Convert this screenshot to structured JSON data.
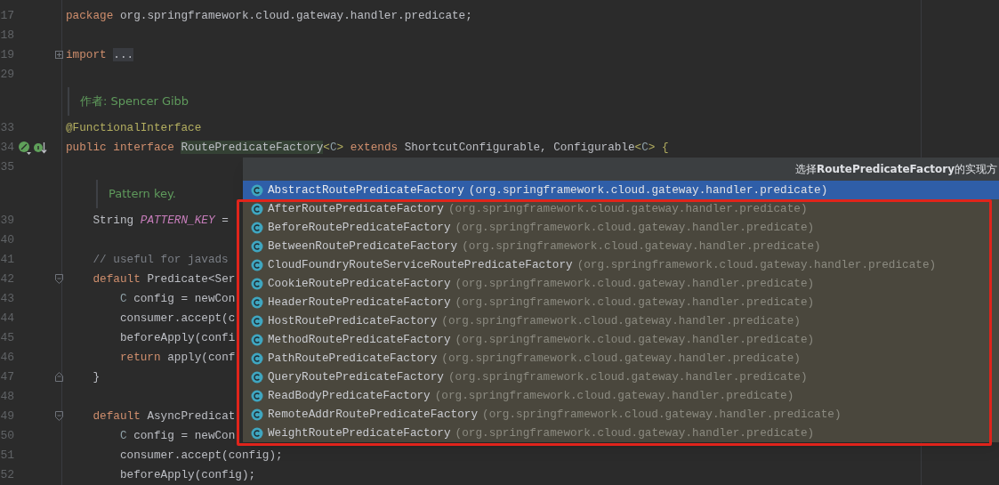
{
  "editor": {
    "lines": [
      {
        "kind": "code",
        "num": "17",
        "tokens": [
          {
            "t": "package ",
            "kind": "kw"
          },
          {
            "t": "org.springframework.cloud.gateway.handler.predicate;",
            "kind": "plain"
          }
        ]
      },
      {
        "kind": "code",
        "num": "18"
      },
      {
        "kind": "code",
        "num": "19",
        "fold": {
          "kind": "collapsed"
        },
        "tokens": [
          {
            "t": "import ",
            "kind": "kw"
          },
          {
            "t": "...",
            "kind": "folded"
          }
        ]
      },
      {
        "kind": "code",
        "num": "29"
      },
      {
        "kind": "doc",
        "text": "作者: Spencer Gibb"
      },
      {
        "kind": "code",
        "num": "33",
        "tokens": [
          {
            "t": "@FunctionalInterface",
            "kind": "annotation"
          }
        ]
      },
      {
        "kind": "code",
        "num": "34",
        "gutter_icons": true,
        "tokens": [
          {
            "t": "public interface ",
            "kind": "kw"
          },
          {
            "t": "RoutePredicateFactory",
            "kind": "highlight"
          },
          {
            "t": "<",
            "kind": "annotation"
          },
          {
            "t": "C",
            "kind": "tparam"
          },
          {
            "t": "> ",
            "kind": "annotation"
          },
          {
            "t": "extends ",
            "kind": "kw"
          },
          {
            "t": "ShortcutConfigurable, Configurable",
            "kind": "plain"
          },
          {
            "t": "<",
            "kind": "annotation"
          },
          {
            "t": "C",
            "kind": "tparam"
          },
          {
            "t": "> {",
            "kind": "annotation"
          }
        ]
      },
      {
        "kind": "code",
        "num": "35"
      },
      {
        "kind": "member_doc",
        "text": "Pattern key."
      },
      {
        "kind": "code",
        "num": "39",
        "tokens": [
          {
            "t": "    String ",
            "kind": "plain"
          },
          {
            "t": "PATTERN_KEY",
            "kind": "static"
          },
          {
            "t": " =",
            "kind": "plain"
          }
        ]
      },
      {
        "kind": "code",
        "num": "40"
      },
      {
        "kind": "code",
        "num": "41",
        "tokens": [
          {
            "t": "    // useful for javads",
            "kind": "comment"
          }
        ]
      },
      {
        "kind": "code",
        "num": "42",
        "fold": {
          "kind": "start"
        },
        "tokens": [
          {
            "t": "    default ",
            "kind": "kw"
          },
          {
            "t": "Predicate<Ser",
            "kind": "plain"
          }
        ]
      },
      {
        "kind": "code",
        "num": "43",
        "tokens": [
          {
            "t": "        C",
            "kind": "tparam"
          },
          {
            "t": " config = newCon",
            "kind": "plain"
          }
        ]
      },
      {
        "kind": "code",
        "num": "44",
        "tokens": [
          {
            "t": "        consumer.accept(c",
            "kind": "plain"
          }
        ]
      },
      {
        "kind": "code",
        "num": "45",
        "tokens": [
          {
            "t": "        beforeApply(confi",
            "kind": "plain"
          }
        ]
      },
      {
        "kind": "code",
        "num": "46",
        "tokens": [
          {
            "t": "        return ",
            "kind": "kw"
          },
          {
            "t": "apply(conf",
            "kind": "plain"
          }
        ]
      },
      {
        "kind": "code",
        "num": "47",
        "fold": {
          "kind": "end"
        },
        "tokens": [
          {
            "t": "    }",
            "kind": "plain"
          }
        ]
      },
      {
        "kind": "code",
        "num": "48"
      },
      {
        "kind": "code",
        "num": "49",
        "fold": {
          "kind": "start"
        },
        "tokens": [
          {
            "t": "    default ",
            "kind": "kw"
          },
          {
            "t": "AsyncPredicat",
            "kind": "plain"
          }
        ]
      },
      {
        "kind": "code",
        "num": "50",
        "tokens": [
          {
            "t": "        C",
            "kind": "tparam"
          },
          {
            "t": " config = newCon",
            "kind": "plain"
          }
        ]
      },
      {
        "kind": "code",
        "num": "51",
        "tokens": [
          {
            "t": "        consumer.accept(config);",
            "kind": "plain"
          }
        ]
      },
      {
        "kind": "code",
        "num": "52",
        "tokens": [
          {
            "t": "        beforeApply(config);",
            "kind": "plain"
          }
        ]
      }
    ]
  },
  "popup": {
    "title": "选择**RoutePredicateFactory**的实现方",
    "items": [
      {
        "name": "AbstractRoutePredicateFactory",
        "package": "(org.springframework.cloud.gateway.handler.predicate)",
        "selected": true
      },
      {
        "name": "AfterRoutePredicateFactory",
        "package": "(org.springframework.cloud.gateway.handler.predicate)",
        "selected": false
      },
      {
        "name": "BeforeRoutePredicateFactory",
        "package": "(org.springframework.cloud.gateway.handler.predicate)",
        "selected": false
      },
      {
        "name": "BetweenRoutePredicateFactory",
        "package": "(org.springframework.cloud.gateway.handler.predicate)",
        "selected": false
      },
      {
        "name": "CloudFoundryRouteServiceRoutePredicateFactory",
        "package": "(org.springframework.cloud.gateway.handler.predicate)",
        "selected": false
      },
      {
        "name": "CookieRoutePredicateFactory",
        "package": "(org.springframework.cloud.gateway.handler.predicate)",
        "selected": false
      },
      {
        "name": "HeaderRoutePredicateFactory",
        "package": "(org.springframework.cloud.gateway.handler.predicate)",
        "selected": false
      },
      {
        "name": "HostRoutePredicateFactory",
        "package": "(org.springframework.cloud.gateway.handler.predicate)",
        "selected": false
      },
      {
        "name": "MethodRoutePredicateFactory",
        "package": "(org.springframework.cloud.gateway.handler.predicate)",
        "selected": false
      },
      {
        "name": "PathRoutePredicateFactory",
        "package": "(org.springframework.cloud.gateway.handler.predicate)",
        "selected": false
      },
      {
        "name": "QueryRoutePredicateFactory",
        "package": "(org.springframework.cloud.gateway.handler.predicate)",
        "selected": false
      },
      {
        "name": "ReadBodyPredicateFactory",
        "package": "(org.springframework.cloud.gateway.handler.predicate)",
        "selected": false
      },
      {
        "name": "RemoteAddrRoutePredicateFactory",
        "package": "(org.springframework.cloud.gateway.handler.predicate)",
        "selected": false
      },
      {
        "name": "WeightRoutePredicateFactory",
        "package": "(org.springframework.cloud.gateway.handler.predicate)",
        "selected": false
      }
    ]
  },
  "annotation": {
    "kind": "rectangle"
  }
}
